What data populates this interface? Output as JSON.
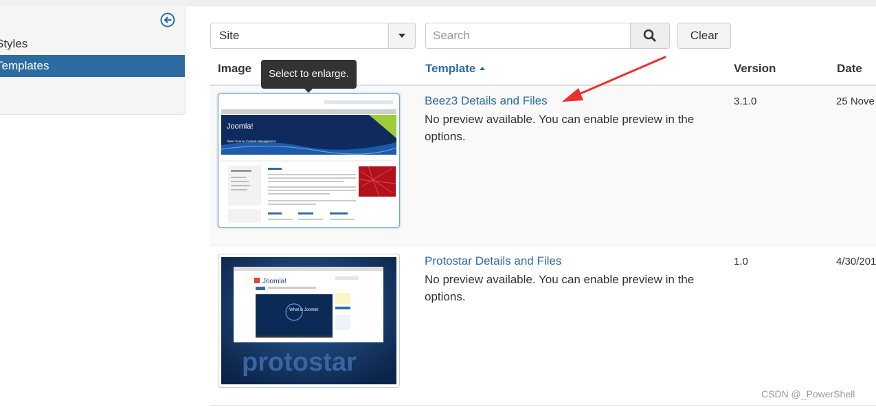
{
  "sidebar": {
    "items": [
      {
        "label": "Styles",
        "active": false
      },
      {
        "label": "Templates",
        "active": true
      }
    ]
  },
  "filters": {
    "client_select": "Site",
    "search_placeholder": "Search",
    "clear_label": "Clear"
  },
  "table": {
    "headers": {
      "image": "Image",
      "template": "Template",
      "version": "Version",
      "date": "Date"
    },
    "rows": [
      {
        "name": "Beez3 Details and Files",
        "description": "No preview available. You can enable preview in the options.",
        "version": "3.1.0",
        "date": "25 Nove"
      },
      {
        "name": "Protostar Details and Files",
        "description": "No preview available. You can enable preview in the options.",
        "version": "1.0",
        "date": "4/30/201"
      }
    ]
  },
  "tooltip": "Select to enlarge.",
  "thumbnails": {
    "beez3": {
      "brand": "Joomla!",
      "tagline": "Open Source Content Management"
    },
    "protostar": {
      "brand": "Joomla!",
      "word": "protostar",
      "video_title": "What is Joomla!"
    }
  },
  "annotation_arrow_color": "#ee2f2f",
  "watermark": "CSDN @_PowerShell",
  "colors": {
    "link": "#2d6ca2",
    "active_bg": "#2d6ca2",
    "tooltip_bg": "#333333"
  }
}
